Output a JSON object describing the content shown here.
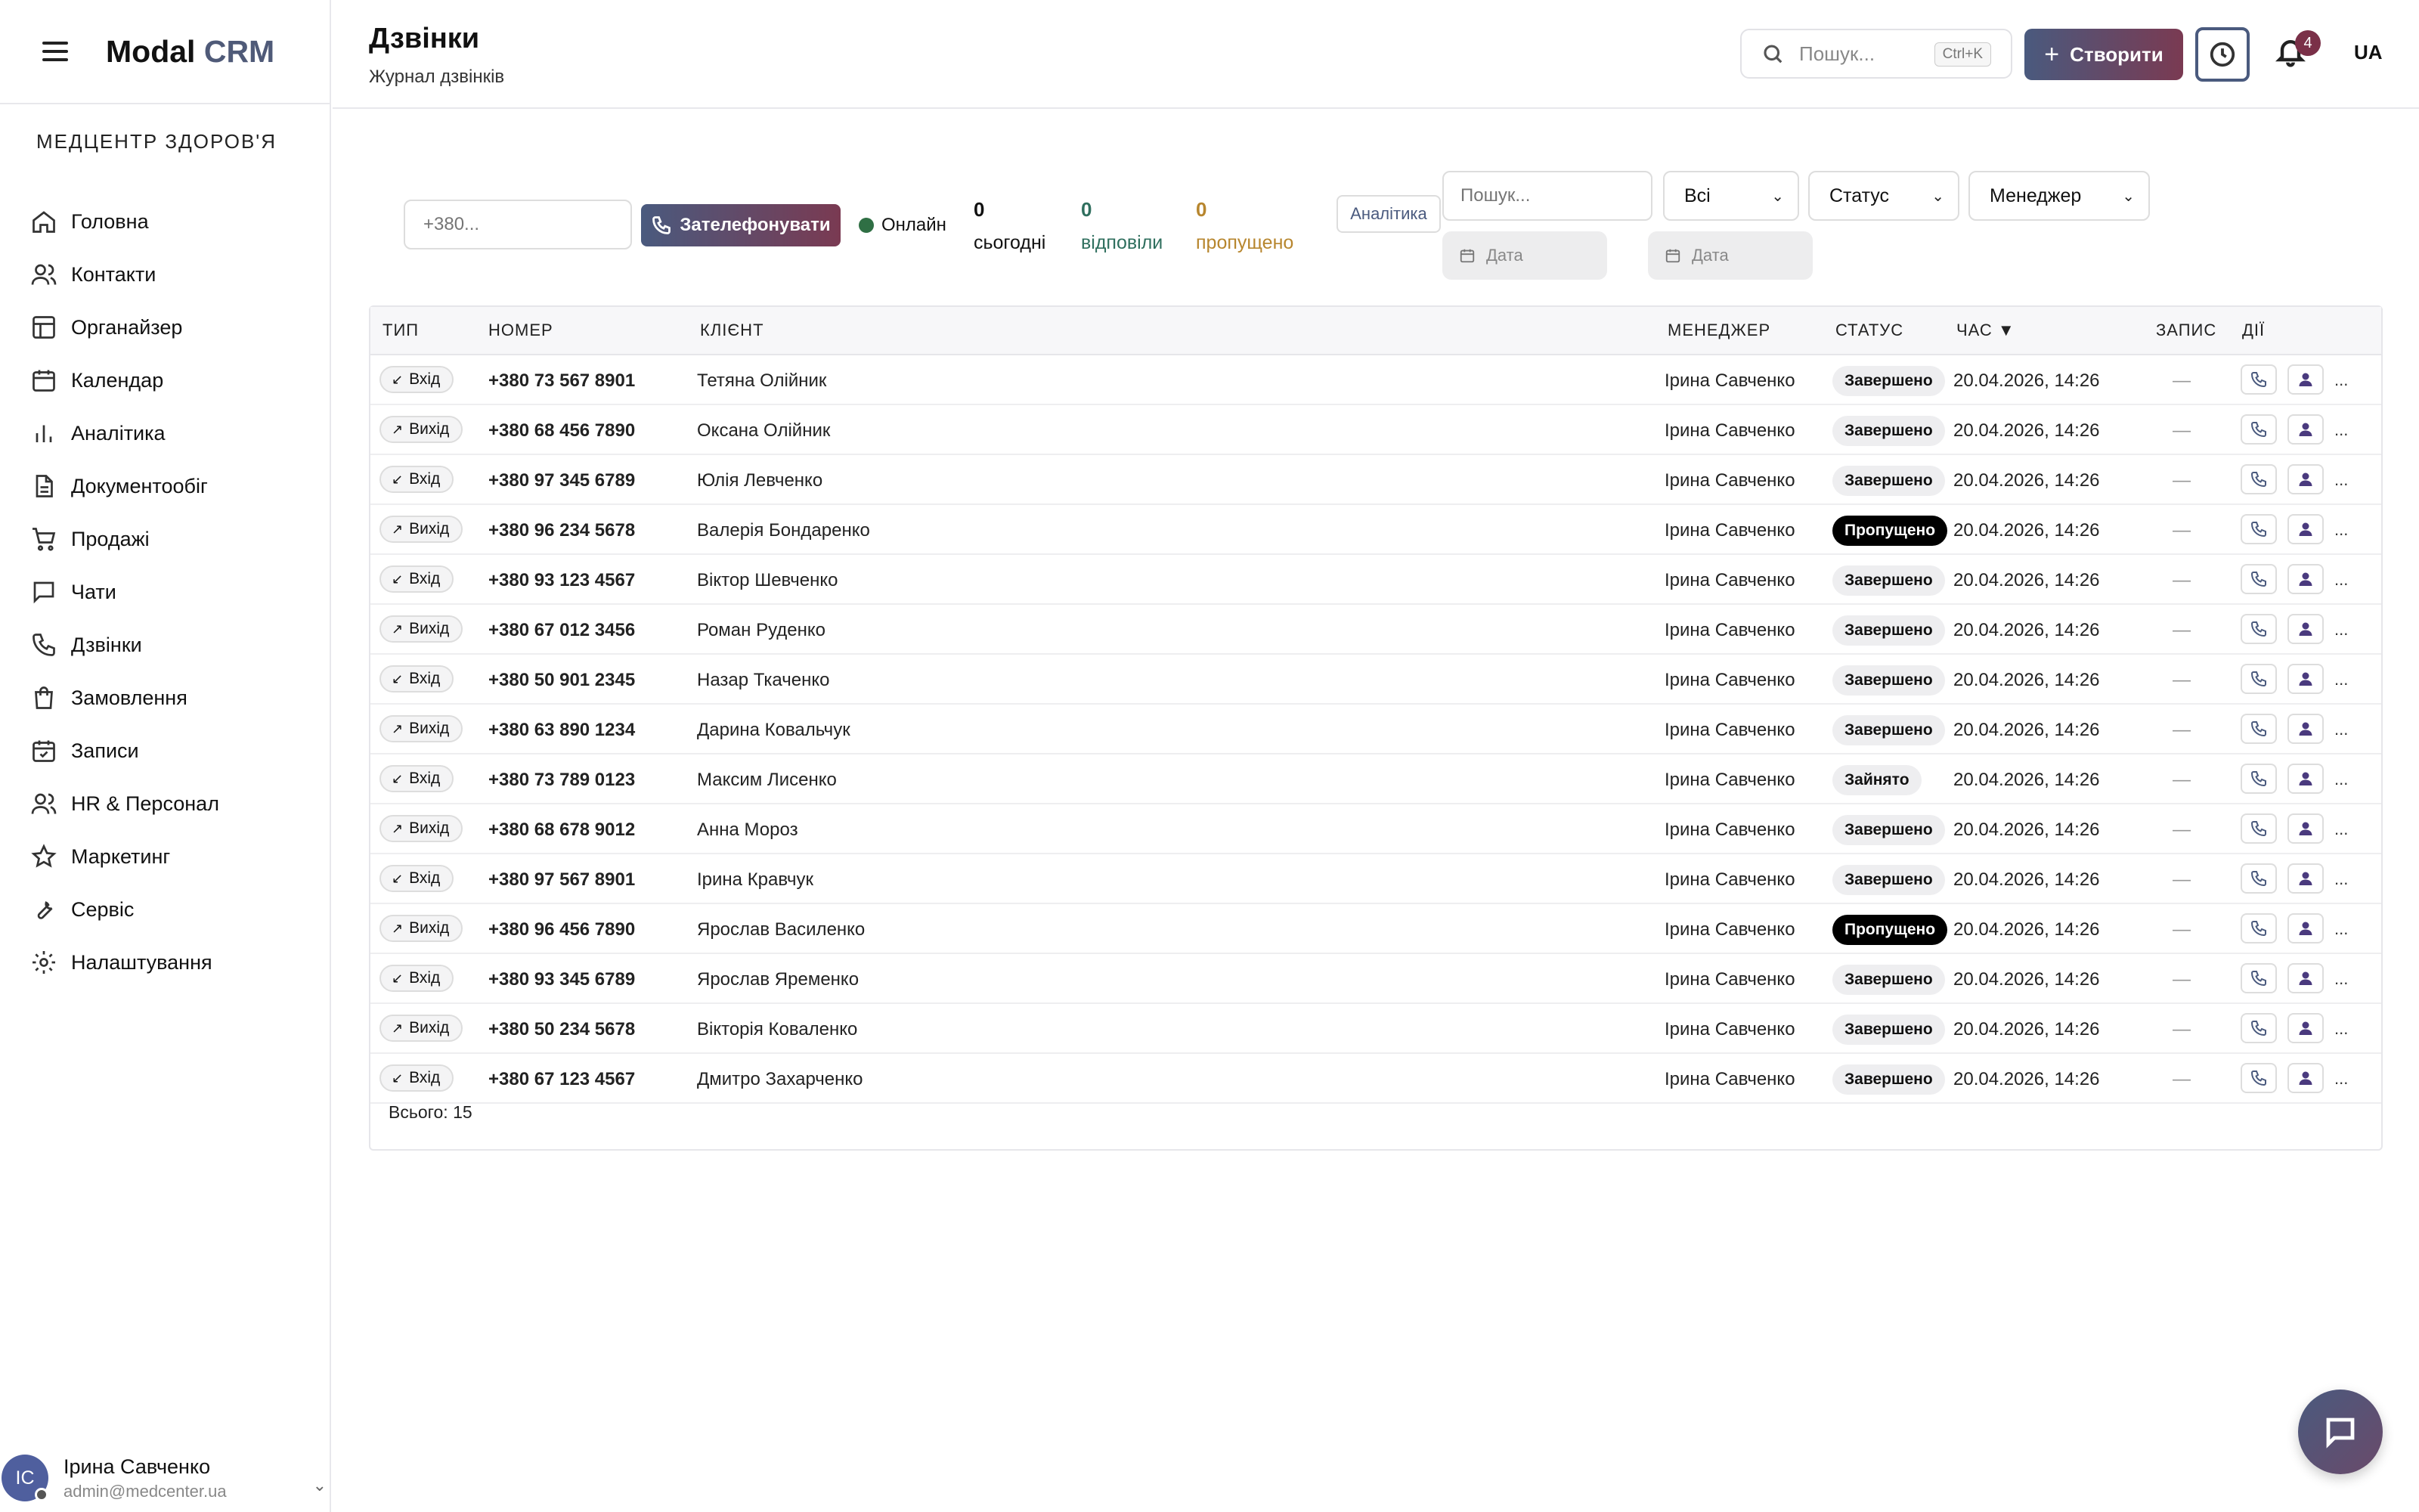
{
  "app": {
    "logo_main": "Modal",
    "logo_accent": "CRM",
    "org_name": "МЕДЦЕНТР ЗДОРОВ'Я"
  },
  "sidebar": {
    "items": [
      {
        "label": "Головна",
        "icon": "home-icon"
      },
      {
        "label": "Контакти",
        "icon": "users-icon"
      },
      {
        "label": "Органайзер",
        "icon": "layout-icon"
      },
      {
        "label": "Календар",
        "icon": "calendar-icon"
      },
      {
        "label": "Аналітика",
        "icon": "bar-chart-icon"
      },
      {
        "label": "Документообіг",
        "icon": "file-icon"
      },
      {
        "label": "Продажі",
        "icon": "cart-icon"
      },
      {
        "label": "Чати",
        "icon": "chat-icon"
      },
      {
        "label": "Дзвінки",
        "icon": "phone-icon"
      },
      {
        "label": "Замовлення",
        "icon": "bag-icon"
      },
      {
        "label": "Записи",
        "icon": "calendar-check-icon"
      },
      {
        "label": "HR & Персонал",
        "icon": "users-icon"
      },
      {
        "label": "Маркетинг",
        "icon": "star-icon"
      },
      {
        "label": "Сервіс",
        "icon": "wrench-icon"
      },
      {
        "label": "Налаштування",
        "icon": "gear-icon"
      }
    ]
  },
  "user": {
    "initials": "ІС",
    "name": "Ірина Савченко",
    "email": "admin@medcenter.ua"
  },
  "header": {
    "title": "Дзвінки",
    "subtitle": "Журнал дзвінків",
    "search_placeholder": "Пошук...",
    "search_shortcut": "Ctrl+K",
    "create_label": "Створити",
    "notifications_count": "4",
    "language": "UA"
  },
  "toolbar": {
    "phone_placeholder": "+380...",
    "call_label": "Зателефонувати",
    "online_label": "Онлайн",
    "stats": {
      "today_value": "0",
      "today_label": "сьогодні",
      "answered_value": "0",
      "answered_label": "відповіли",
      "missed_value": "0",
      "missed_label": "пропущено"
    },
    "analytics_label": "Аналітика",
    "search_placeholder": "Пошук...",
    "filter_all": "Всі",
    "filter_status": "Статус",
    "filter_manager": "Менеджер",
    "date_from_placeholder": "Дата",
    "date_to_placeholder": "Дата"
  },
  "table": {
    "headers": {
      "type": "ТИП",
      "number": "НОМЕР",
      "client": "КЛІЄНТ",
      "manager": "МЕНЕДЖЕР",
      "status": "СТАТУС",
      "time": "ЧАС ▼",
      "record": "ЗАПИС",
      "actions": "ДІЇ"
    },
    "rows": [
      {
        "direction": "in",
        "type": "Вхід",
        "number": "+380 73 567 8901",
        "client": "Тетяна Олійник",
        "manager": "Ірина Савченко",
        "status": "Завершено",
        "time": "20.04.2026, 14:26",
        "record": "—"
      },
      {
        "direction": "out",
        "type": "Вихід",
        "number": "+380 68 456 7890",
        "client": "Оксана Олійник",
        "manager": "Ірина Савченко",
        "status": "Завершено",
        "time": "20.04.2026, 14:26",
        "record": "—"
      },
      {
        "direction": "in",
        "type": "Вхід",
        "number": "+380 97 345 6789",
        "client": "Юлія Левченко",
        "manager": "Ірина Савченко",
        "status": "Завершено",
        "time": "20.04.2026, 14:26",
        "record": "—"
      },
      {
        "direction": "out",
        "type": "Вихід",
        "number": "+380 96 234 5678",
        "client": "Валерія Бондаренко",
        "manager": "Ірина Савченко",
        "status": "Пропущено",
        "time": "20.04.2026, 14:26",
        "record": "—"
      },
      {
        "direction": "in",
        "type": "Вхід",
        "number": "+380 93 123 4567",
        "client": "Віктор Шевченко",
        "manager": "Ірина Савченко",
        "status": "Завершено",
        "time": "20.04.2026, 14:26",
        "record": "—"
      },
      {
        "direction": "out",
        "type": "Вихід",
        "number": "+380 67 012 3456",
        "client": "Роман Руденко",
        "manager": "Ірина Савченко",
        "status": "Завершено",
        "time": "20.04.2026, 14:26",
        "record": "—"
      },
      {
        "direction": "in",
        "type": "Вхід",
        "number": "+380 50 901 2345",
        "client": "Назар Ткаченко",
        "manager": "Ірина Савченко",
        "status": "Завершено",
        "time": "20.04.2026, 14:26",
        "record": "—"
      },
      {
        "direction": "out",
        "type": "Вихід",
        "number": "+380 63 890 1234",
        "client": "Дарина Ковальчук",
        "manager": "Ірина Савченко",
        "status": "Завершено",
        "time": "20.04.2026, 14:26",
        "record": "—"
      },
      {
        "direction": "in",
        "type": "Вхід",
        "number": "+380 73 789 0123",
        "client": "Максим Лисенко",
        "manager": "Ірина Савченко",
        "status": "Зайнято",
        "time": "20.04.2026, 14:26",
        "record": "—"
      },
      {
        "direction": "out",
        "type": "Вихід",
        "number": "+380 68 678 9012",
        "client": "Анна Мороз",
        "manager": "Ірина Савченко",
        "status": "Завершено",
        "time": "20.04.2026, 14:26",
        "record": "—"
      },
      {
        "direction": "in",
        "type": "Вхід",
        "number": "+380 97 567 8901",
        "client": "Ірина Кравчук",
        "manager": "Ірина Савченко",
        "status": "Завершено",
        "time": "20.04.2026, 14:26",
        "record": "—"
      },
      {
        "direction": "out",
        "type": "Вихід",
        "number": "+380 96 456 7890",
        "client": "Ярослав Василенко",
        "manager": "Ірина Савченко",
        "status": "Пропущено",
        "time": "20.04.2026, 14:26",
        "record": "—"
      },
      {
        "direction": "in",
        "type": "Вхід",
        "number": "+380 93 345 6789",
        "client": "Ярослав Яременко",
        "manager": "Ірина Савченко",
        "status": "Завершено",
        "time": "20.04.2026, 14:26",
        "record": "—"
      },
      {
        "direction": "out",
        "type": "Вихід",
        "number": "+380 50 234 5678",
        "client": "Вікторія Коваленко",
        "manager": "Ірина Савченко",
        "status": "Завершено",
        "time": "20.04.2026, 14:26",
        "record": "—"
      },
      {
        "direction": "in",
        "type": "Вхід",
        "number": "+380 67 123 4567",
        "client": "Дмитро Захарченко",
        "manager": "Ірина Савченко",
        "status": "Завершено",
        "time": "20.04.2026, 14:26",
        "record": "—"
      }
    ],
    "total_label": "Всього: 15"
  },
  "colors": {
    "accent_start": "#4a5a7e",
    "accent_end": "#7a3a52",
    "answered": "#2f6f5e",
    "missed": "#b7862e",
    "online": "#2f6f44",
    "badge": "#7a3048"
  }
}
